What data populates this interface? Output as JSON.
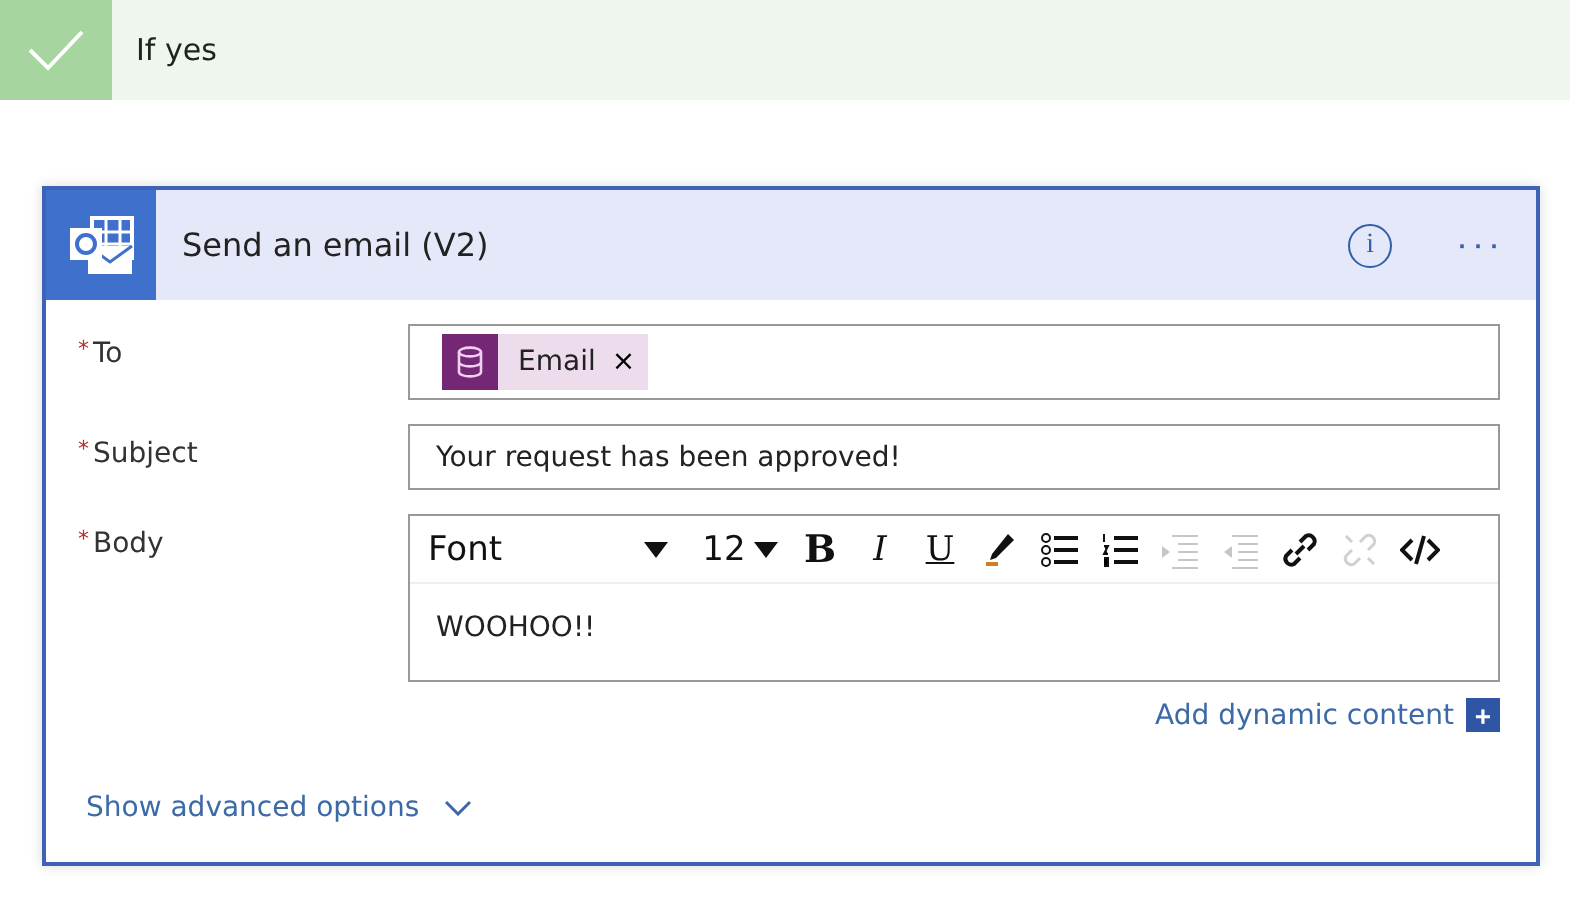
{
  "branch": {
    "title": "If yes",
    "succeeded": true
  },
  "action": {
    "title": "Send an email (V2)",
    "info": "i",
    "more": "···"
  },
  "fields": [
    {
      "kind": "tokens",
      "label": "To",
      "marker": "*",
      "tokens": [
        {
          "label": "Email",
          "remove": "×"
        }
      ]
    },
    {
      "kind": "text",
      "label": "Subject",
      "marker": "*",
      "value": "Your request has been approved!"
    },
    {
      "kind": "richtext",
      "label": "Body",
      "marker": "*",
      "value": "WOOHOO!!",
      "toolbar": [
        {
          "kind": "font",
          "label": "Font",
          "disabled": false
        },
        {
          "kind": "size",
          "label": "12",
          "disabled": false
        },
        {
          "kind": "bold",
          "label": "B",
          "disabled": false
        },
        {
          "kind": "italic",
          "label": "I",
          "disabled": false
        },
        {
          "kind": "underline",
          "label": "U",
          "disabled": false
        },
        {
          "kind": "color",
          "disabled": false
        },
        {
          "kind": "bullets",
          "disabled": false
        },
        {
          "kind": "numbers",
          "disabled": false
        },
        {
          "kind": "indent",
          "disabled": true
        },
        {
          "kind": "outdent",
          "disabled": true
        },
        {
          "kind": "link",
          "disabled": false
        },
        {
          "kind": "unlink",
          "disabled": true
        },
        {
          "kind": "code",
          "disabled": false
        }
      ]
    }
  ],
  "dynamic_content": {
    "label": "Add dynamic content",
    "button": "+"
  },
  "advanced": {
    "label": "Show advanced options",
    "expanded": false
  }
}
